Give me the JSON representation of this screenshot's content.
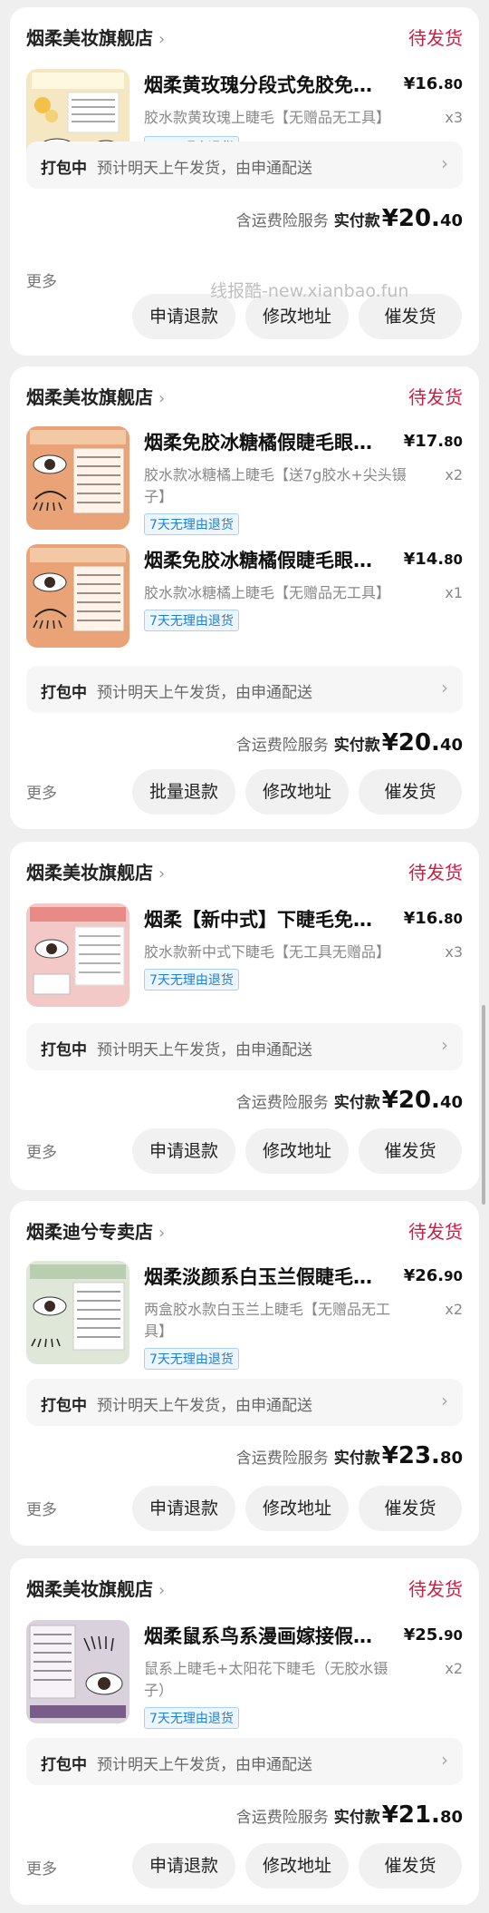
{
  "orders": [
    {
      "shop": "烟柔美妆旗舰店",
      "status": "待发货",
      "items": [
        {
          "title": "烟柔黄玫瑰分段式免胶免…",
          "spec": "胶水款黄玫瑰上睫毛【无赠品无工具】",
          "tag": "7天无理由退货",
          "price_int": "¥16.",
          "price_dec": "80",
          "qty": "x3"
        }
      ],
      "pack_label": "打包中",
      "pack_text": "预计明天上午发货，由申通配送",
      "pay_note": "含运费险服务",
      "pay_label": "实付款",
      "pay_int": "¥20.",
      "pay_dec": "40",
      "more": "更多",
      "buttons": [
        "申请退款",
        "修改地址",
        "催发货"
      ]
    },
    {
      "shop": "烟柔美妆旗舰店",
      "status": "待发货",
      "items": [
        {
          "title": "烟柔免胶冰糖橘假睫毛眼…",
          "spec": "胶水款冰糖橘上睫毛【送7g胶水+尖头镊子】",
          "tag": "7天无理由退货",
          "price_int": "¥17.",
          "price_dec": "80",
          "qty": "x2"
        },
        {
          "title": "烟柔免胶冰糖橘假睫毛眼…",
          "spec": "胶水款冰糖橘上睫毛【无赠品无工具】",
          "tag": "7天无理由退货",
          "price_int": "¥14.",
          "price_dec": "80",
          "qty": "x1"
        }
      ],
      "pack_label": "打包中",
      "pack_text": "预计明天上午发货，由申通配送",
      "pay_note": "含运费险服务",
      "pay_label": "实付款",
      "pay_int": "¥20.",
      "pay_dec": "40",
      "more": "更多",
      "buttons": [
        "批量退款",
        "修改地址",
        "催发货"
      ]
    },
    {
      "shop": "烟柔美妆旗舰店",
      "status": "待发货",
      "items": [
        {
          "title": "烟柔【新中式】下睫毛免胶…",
          "spec": "胶水款新中式下睫毛【无工具无赠品】",
          "tag": "7天无理由退货",
          "price_int": "¥16.",
          "price_dec": "80",
          "qty": "x3"
        }
      ],
      "pack_label": "打包中",
      "pack_text": "预计明天上午发货，由申通配送",
      "pay_note": "含运费险服务",
      "pay_label": "实付款",
      "pay_int": "¥20.",
      "pay_dec": "40",
      "more": "更多",
      "buttons": [
        "申请退款",
        "修改地址",
        "催发货"
      ]
    },
    {
      "shop": "烟柔迪兮专卖店",
      "status": "待发货",
      "items": [
        {
          "title": "烟柔淡颜系白玉兰假睫毛…",
          "spec": "两盒胶水款白玉兰上睫毛【无赠品无工具】",
          "tag": "7天无理由退货",
          "price_int": "¥26.",
          "price_dec": "90",
          "qty": "x2"
        }
      ],
      "pack_label": "打包中",
      "pack_text": "预计明天上午发货，由申通配送",
      "pay_note": "含运费险服务",
      "pay_label": "实付款",
      "pay_int": "¥23.",
      "pay_dec": "80",
      "more": "更多",
      "buttons": [
        "申请退款",
        "修改地址",
        "催发货"
      ]
    },
    {
      "shop": "烟柔美妆旗舰店",
      "status": "待发货",
      "items": [
        {
          "title": "烟柔鼠系鸟系漫画嫁接假…",
          "spec": "鼠系上睫毛+太阳花下睫毛（无胶水镊子）",
          "tag": "7天无理由退货",
          "price_int": "¥25.",
          "price_dec": "90",
          "qty": "x2"
        }
      ],
      "pack_label": "打包中",
      "pack_text": "预计明天上午发货，由申通配送",
      "pay_note": "含运费险服务",
      "pay_label": "实付款",
      "pay_int": "¥21.",
      "pay_dec": "80",
      "more": "更多",
      "buttons": [
        "申请退款",
        "修改地址",
        "催发货"
      ]
    }
  ],
  "watermark": "线报酷-new.xianbao.fun",
  "colors": {
    "status": "#d21a44",
    "tag": "#1f7fd6",
    "card": "#ffffff",
    "background": "#efefef"
  }
}
